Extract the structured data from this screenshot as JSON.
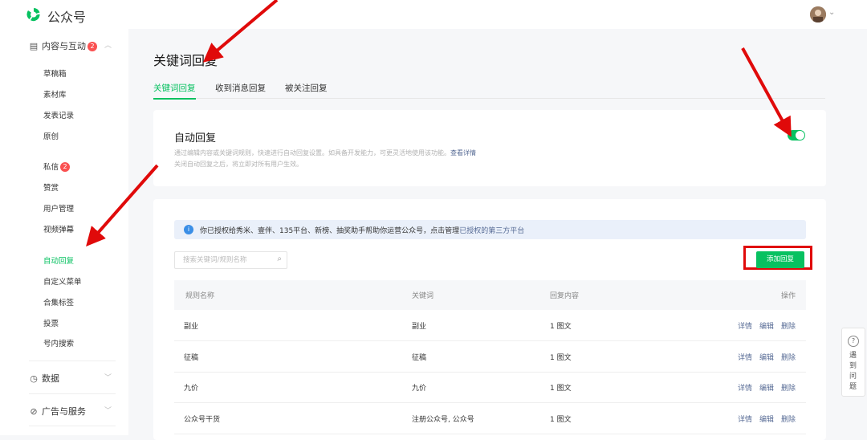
{
  "app": {
    "brand": "公众号"
  },
  "sidebar": {
    "group_content": {
      "label": "内容与互动",
      "badge": "2"
    },
    "content_items": [
      {
        "label": "草稿箱"
      },
      {
        "label": "素材库"
      },
      {
        "label": "发表记录"
      },
      {
        "label": "原创"
      }
    ],
    "inbox": {
      "label": "私信",
      "badge": "2"
    },
    "items2": [
      {
        "label": "赞赏"
      },
      {
        "label": "用户管理"
      },
      {
        "label": "视频弹幕"
      }
    ],
    "items3": [
      {
        "label": "自动回复",
        "active": true
      },
      {
        "label": "自定义菜单"
      },
      {
        "label": "合集标签"
      },
      {
        "label": "投票"
      },
      {
        "label": "号内搜索"
      }
    ],
    "group_data": {
      "label": "数据"
    },
    "group_ads": {
      "label": "广告与服务"
    }
  },
  "page": {
    "title": "关键词回复",
    "tabs": [
      {
        "label": "关键词回复",
        "active": true
      },
      {
        "label": "收到消息回复"
      },
      {
        "label": "被关注回复"
      }
    ]
  },
  "auto_reply": {
    "title": "自动回复",
    "desc_line1": "通过编辑内容或关键词规则，快速进行自动回复设置。如具备开发能力，可更灵活地使用该功能。",
    "desc_link": "查看详情",
    "desc_line2": "关闭自动回复之后，将立即对所有用户生效。",
    "enabled": true
  },
  "notice": {
    "text": "你已授权给秀米、壹伴、135平台、新榜、抽奖助手帮助你运营公众号，点击管理",
    "link": "已授权的第三方平台"
  },
  "search": {
    "placeholder": "搜索关键词/规则名称"
  },
  "add_button": "添加回复",
  "table": {
    "headers": [
      "规则名称",
      "关键词",
      "回复内容",
      "操作"
    ],
    "rows": [
      {
        "name": "副业",
        "keyword": "副业",
        "content": "1 图文"
      },
      {
        "name": "征稿",
        "keyword": "征稿",
        "content": "1 图文"
      },
      {
        "name": "九价",
        "keyword": "九价",
        "content": "1 图文"
      },
      {
        "name": "公众号干货",
        "keyword": "注册公众号, 公众号",
        "content": "1 图文"
      }
    ],
    "actions": {
      "detail": "详情",
      "edit": "编辑",
      "delete": "删除"
    }
  },
  "helper": {
    "label": "遇到问题"
  },
  "colors": {
    "accent": "#07c160",
    "badge": "#fa5151",
    "link": "#576b95",
    "annotation": "#e00a0a"
  },
  "icons": [
    "wechat-logo-icon",
    "document-icon",
    "chevron-up-icon",
    "chevron-down-icon",
    "clock-icon",
    "compass-icon",
    "info-icon",
    "search-icon",
    "question-icon",
    "annotation-arrow-icon"
  ]
}
